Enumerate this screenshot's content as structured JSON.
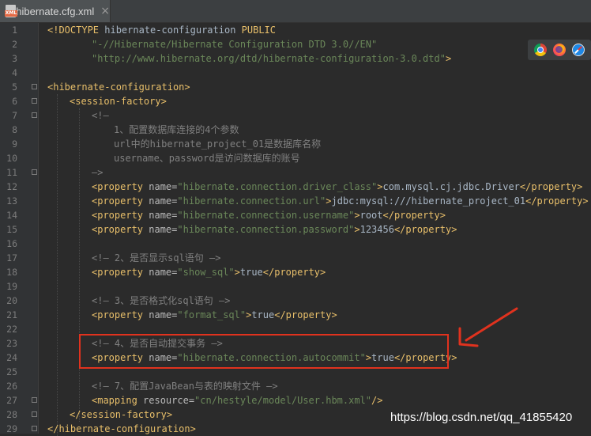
{
  "tab": {
    "file_name": "hibernate.cfg.xml",
    "close": "×",
    "icon_tag": "XML"
  },
  "line_numbers": [
    "1",
    "2",
    "3",
    "4",
    "5",
    "6",
    "7",
    "8",
    "9",
    "10",
    "11",
    "12",
    "13",
    "14",
    "15",
    "16",
    "17",
    "18",
    "19",
    "20",
    "21",
    "22",
    "23",
    "24",
    "25",
    "26",
    "27",
    "28",
    "29"
  ],
  "code": {
    "l1": {
      "doctype": "<!DOCTYPE",
      "text": " hibernate-configuration ",
      "public": "PUBLIC"
    },
    "l2": "\"-//Hibernate/Hibernate Configuration DTD 3.0//EN\"",
    "l3": {
      "val": "\"http://www.hibernate.org/dtd/hibernate-configuration-3.0.dtd\"",
      "close": ">"
    },
    "l5": "<hibernate-configuration>",
    "l6": "<session-factory>",
    "l7": "<!—",
    "l8": "1、配置数据库连接的4个参数",
    "l9": "url中的hibernate_project_01是数据库名称",
    "l10": "username、password是访问数据库的账号",
    "l11": "—>",
    "prop_open": "<property",
    "prop_name_attr": " name=",
    "prop_close_tag": "</property>",
    "gt": ">",
    "p12": {
      "name": "\"hibernate.connection.driver_class\"",
      "value": "com.mysql.cj.jdbc.Driver"
    },
    "p13": {
      "name": "\"hibernate.connection.url\"",
      "value": "jdbc:mysql:///hibernate_project_01"
    },
    "p14": {
      "name": "\"hibernate.connection.username\"",
      "value": "root"
    },
    "p15": {
      "name": "\"hibernate.connection.password\"",
      "value": "123456"
    },
    "l17": "<!— 2、是否显示sql语句 —>",
    "p18": {
      "name": "\"show_sql\"",
      "value": "true"
    },
    "l20": "<!— 3、是否格式化sql语句 —>",
    "p21": {
      "name": "\"format_sql\"",
      "value": "true"
    },
    "l23": "<!— 4、是否自动提交事务 —>",
    "p24": {
      "name": "\"hibernate.connection.autocommit\"",
      "value": "true"
    },
    "l26": "<!— 7、配置JavaBean与表的映射文件 —>",
    "l27": {
      "open": "<mapping",
      "attr": " resource=",
      "val": "\"cn/hestyle/model/User.hbm.xml\"",
      "close": "/>"
    },
    "l28": "</session-factory>",
    "l29": "</hibernate-configuration>"
  },
  "browser_icons": [
    "chrome-icon",
    "firefox-icon",
    "safari-icon"
  ],
  "watermark": "https://blog.csdn.net/qq_41855420",
  "colors": {
    "tag": "#e8bf6a",
    "attr_value": "#6a8759",
    "comment": "#808080",
    "text": "#a9b7c6",
    "highlight": "#e0321e"
  }
}
